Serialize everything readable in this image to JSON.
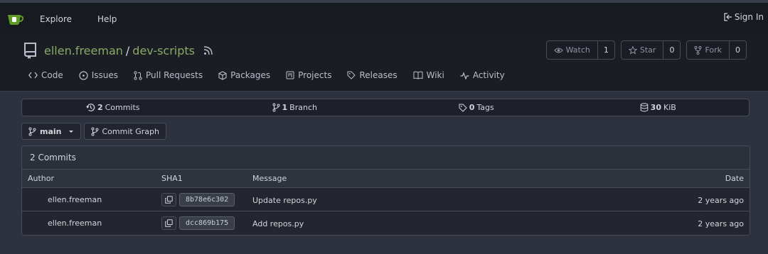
{
  "topnav": {
    "explore": "Explore",
    "help": "Help",
    "sign_in": "Sign In"
  },
  "repo": {
    "owner": "ellen.freeman",
    "separator": "/",
    "name": "dev-scripts"
  },
  "actions": {
    "watch_label": "Watch",
    "watch_count": "1",
    "star_label": "Star",
    "star_count": "0",
    "fork_label": "Fork",
    "fork_count": "0"
  },
  "tabs": [
    {
      "label": "Code",
      "icon": "code-icon"
    },
    {
      "label": "Issues",
      "icon": "issue-icon"
    },
    {
      "label": "Pull Requests",
      "icon": "pull-request-icon"
    },
    {
      "label": "Packages",
      "icon": "package-icon"
    },
    {
      "label": "Projects",
      "icon": "project-icon"
    },
    {
      "label": "Releases",
      "icon": "tag-icon"
    },
    {
      "label": "Wiki",
      "icon": "book-icon"
    },
    {
      "label": "Activity",
      "icon": "pulse-icon"
    }
  ],
  "stats": {
    "commits_count": "2",
    "commits_label": "Commits",
    "branch_count": "1",
    "branch_label": "Branch",
    "tags_count": "0",
    "tags_label": "Tags",
    "size_value": "30",
    "size_unit": "KiB"
  },
  "branch": {
    "current": "main",
    "commit_graph": "Commit Graph"
  },
  "commits": {
    "heading": "2 Commits",
    "columns": {
      "author": "Author",
      "sha": "SHA1",
      "message": "Message",
      "date": "Date"
    },
    "rows": [
      {
        "author": "ellen.freeman",
        "sha": "8b78e6c302",
        "message": "Update repos.py",
        "date": "2 years ago"
      },
      {
        "author": "ellen.freeman",
        "sha": "dcc869b175",
        "message": "Add repos.py",
        "date": "2 years ago"
      }
    ]
  },
  "colors": {
    "accent": "#87ab63",
    "background": "#2e323e",
    "topbar": "#181a21"
  }
}
